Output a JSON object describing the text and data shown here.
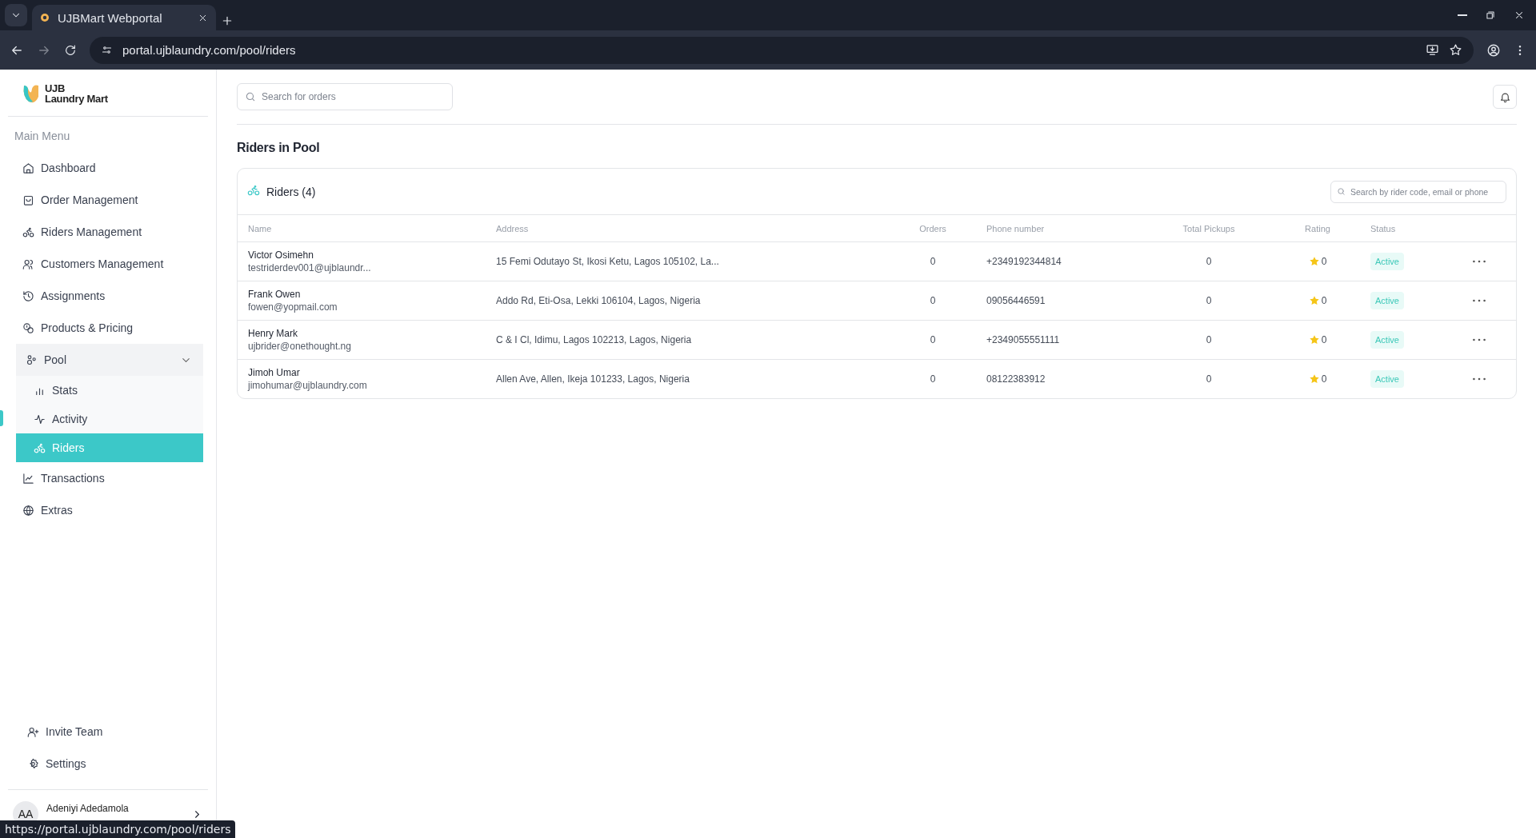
{
  "browser": {
    "tab_title": "UJBMart Webportal",
    "url": "portal.ujblaundry.com/pool/riders",
    "status_url": "https://portal.ujblaundry.com/pool/riders"
  },
  "sidebar": {
    "logo": [
      "UJB",
      "Laundry Mart"
    ],
    "section": "Main Menu",
    "items": [
      {
        "label": "Dashboard",
        "selected": false
      },
      {
        "label": "Order Management",
        "selected": false
      },
      {
        "label": "Riders Management",
        "selected": false
      },
      {
        "label": "Customers Management",
        "selected": false
      },
      {
        "label": "Assignments",
        "selected": false
      },
      {
        "label": "Products & Pricing",
        "selected": false
      },
      {
        "label": "Pool",
        "selected": false,
        "expanded": true,
        "children": [
          {
            "label": "Stats",
            "selected": false
          },
          {
            "label": "Activity",
            "selected": false
          },
          {
            "label": "Riders",
            "selected": true
          }
        ]
      },
      {
        "label": "Transactions",
        "selected": false
      },
      {
        "label": "Extras",
        "selected": false
      }
    ],
    "footer_items": [
      {
        "label": "Invite Team"
      },
      {
        "label": "Settings"
      }
    ],
    "user": {
      "initials": "AA",
      "name": "Adeniyi Adedamola"
    }
  },
  "header": {
    "search": {
      "placeholder": "Search for orders"
    }
  },
  "page_title": "Riders in Pool",
  "card": {
    "title": "Riders (4)",
    "search": {
      "placeholder": "Search by rider code, email or phone"
    },
    "columns": [
      "Name",
      "Address",
      "Orders",
      "Phone number",
      "Total Pickups",
      "Rating",
      "Status"
    ],
    "rows": [
      {
        "name": "Victor Osimehn",
        "email": "testriderdev001@ujblaundr...",
        "address": "15 Femi Odutayo St, Ikosi Ketu, Lagos 105102, La...",
        "orders": "0",
        "phone": "+2349192344814",
        "total_pickups": "0",
        "rating": "0",
        "status": "Active"
      },
      {
        "name": "Frank Owen",
        "email": "fowen@yopmail.com",
        "address": "Addo Rd, Eti-Osa, Lekki 106104, Lagos, Nigeria",
        "orders": "0",
        "phone": "09056446591",
        "total_pickups": "0",
        "rating": "0",
        "status": "Active"
      },
      {
        "name": "Henry Mark",
        "email": "ujbrider@onethought.ng",
        "address": "C & I Cl, Idimu, Lagos 102213, Lagos, Nigeria",
        "orders": "0",
        "phone": "+2349055551111",
        "total_pickups": "0",
        "rating": "0",
        "status": "Active"
      },
      {
        "name": "Jimoh Umar",
        "email": "jimohumar@ujblaundry.com",
        "address": "Allen Ave, Allen, Ikeja 101233, Lagos, Nigeria",
        "orders": "0",
        "phone": "08122383912",
        "total_pickups": "0",
        "rating": "0",
        "status": "Active"
      }
    ]
  }
}
